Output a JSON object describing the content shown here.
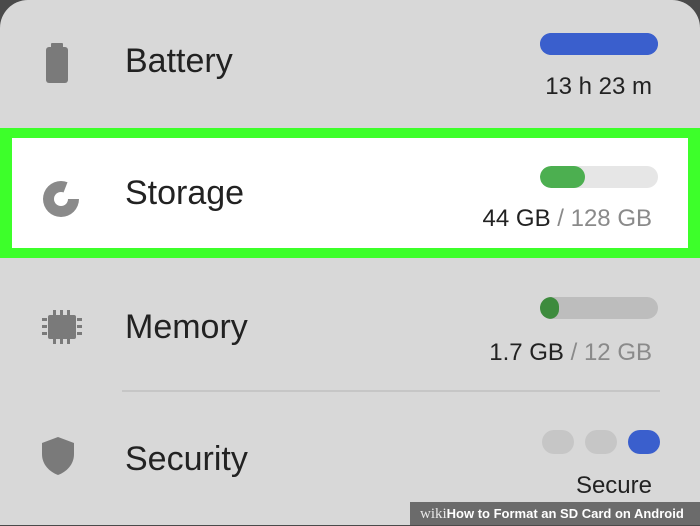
{
  "battery": {
    "label": "Battery",
    "value": "13 h 23 m",
    "level": 1.0,
    "color": "#3a5fcd"
  },
  "storage": {
    "label": "Storage",
    "used": "44 GB",
    "total": "/ 128 GB",
    "level": 0.38,
    "color": "#4caf50",
    "highlight_color": "#3dff2a"
  },
  "memory": {
    "label": "Memory",
    "used": "1.7 GB",
    "total": "/ 12 GB",
    "level": 0.16,
    "color": "#3d8b3d"
  },
  "security": {
    "label": "Security",
    "status": "Secure",
    "active_dot": 3,
    "dot_count": 3,
    "color": "#3a5fcd"
  },
  "watermark": {
    "brand": "wiki",
    "text": "How to Format an SD Card on Android"
  }
}
